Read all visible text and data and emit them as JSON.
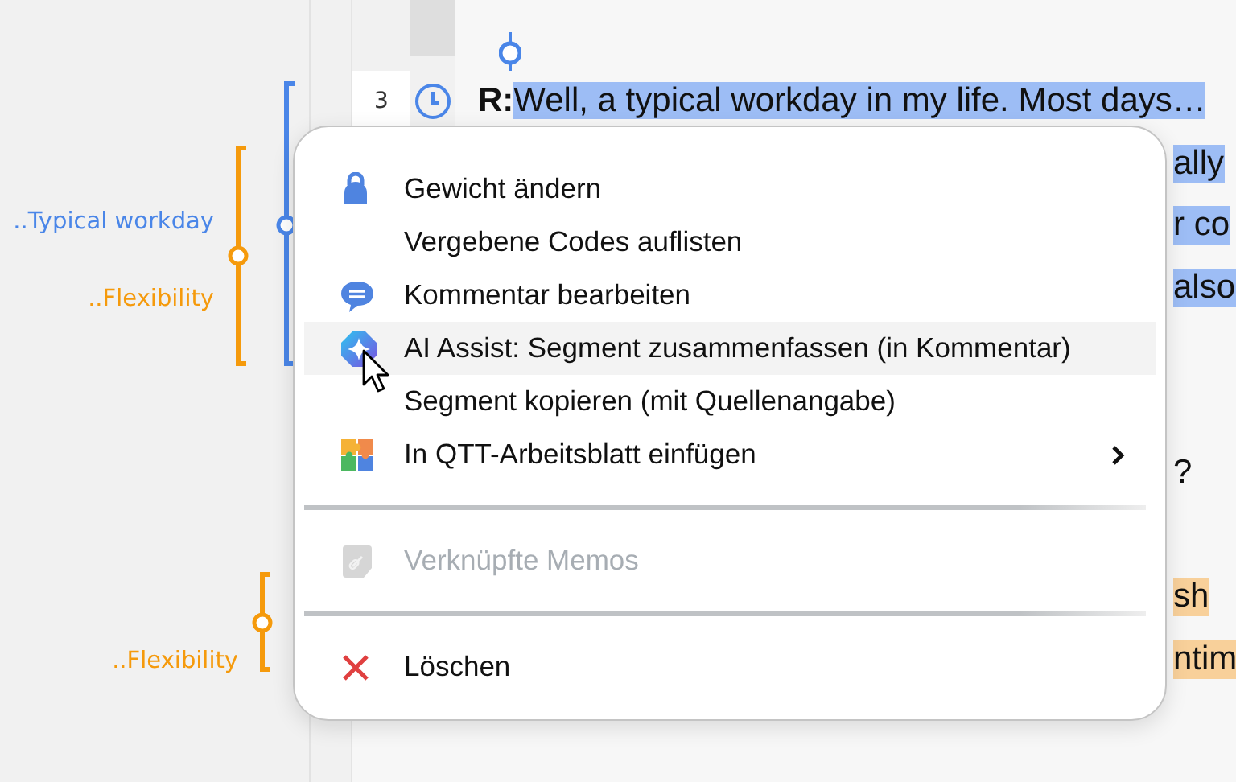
{
  "margin_codes": [
    {
      "label": "..Typical workday",
      "color": "#4a86e8"
    },
    {
      "label": "..Flexibility",
      "color": "#f59a0c"
    },
    {
      "label": "..Flexibility",
      "color": "#f59a0c"
    }
  ],
  "lines": [
    {
      "kind": "full",
      "number": "3",
      "speaker": "R:",
      "text": "Well, a typical workday in my life. Most days…",
      "color": "#9dbdf5"
    },
    {
      "kind": "tail",
      "text": "ally",
      "color": "#9dbdf5"
    },
    {
      "kind": "tail",
      "text": "r co",
      "color": "#9dbdf5"
    },
    {
      "kind": "tail",
      "text": "also",
      "color": "#9dbdf5"
    },
    {
      "kind": "blank"
    },
    {
      "kind": "blank"
    },
    {
      "kind": "tail",
      "text": "?"
    },
    {
      "kind": "blank"
    },
    {
      "kind": "tail",
      "text": "sh",
      "color": "#f8d09a"
    },
    {
      "kind": "tail",
      "text": "ntim",
      "color": "#f8d09a"
    }
  ],
  "menu": {
    "items": [
      {
        "kind": "weight",
        "label": "Gewicht ändern",
        "selected": false,
        "disabled": false,
        "submenu": false
      },
      {
        "kind": "plain",
        "label": "Vergebene Codes auflisten",
        "selected": false,
        "disabled": false,
        "submenu": false
      },
      {
        "kind": "comment",
        "label": "Kommentar bearbeiten",
        "selected": false,
        "disabled": false,
        "submenu": false
      },
      {
        "kind": "ai",
        "label": "AI Assist: Segment zusammenfassen (in Kommentar)",
        "selected": true,
        "disabled": false,
        "submenu": false
      },
      {
        "kind": "plain",
        "label": "Segment kopieren (mit Quellenangabe)",
        "selected": false,
        "disabled": false,
        "submenu": false
      },
      {
        "kind": "worksheet",
        "label": "In QTT-Arbeitsblatt einfügen",
        "selected": false,
        "disabled": false,
        "submenu": true
      },
      {
        "kind": "separator"
      },
      {
        "kind": "memo",
        "label": "Verknüpfte Memos",
        "selected": false,
        "disabled": true,
        "submenu": false
      },
      {
        "kind": "separator"
      },
      {
        "kind": "delete",
        "label": "Löschen",
        "selected": false,
        "disabled": false,
        "submenu": false
      }
    ]
  }
}
